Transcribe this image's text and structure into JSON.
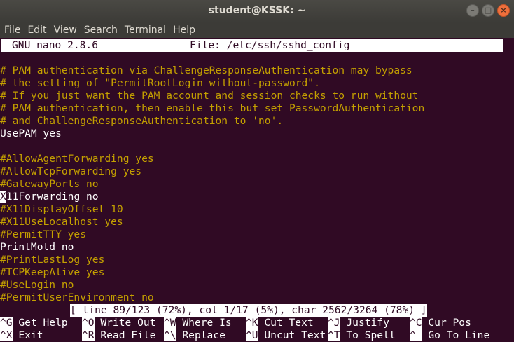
{
  "window": {
    "title": "student@KSSK: ~"
  },
  "menu": [
    "File",
    "Edit",
    "View",
    "Search",
    "Terminal",
    "Help"
  ],
  "editor": {
    "program": "GNU nano 2.8.6",
    "file": "File: /etc/ssh/sshd_config"
  },
  "lines": [
    {
      "text": "",
      "type": "plain"
    },
    {
      "text": "# PAM authentication via ChallengeResponseAuthentication may bypass",
      "type": "comment"
    },
    {
      "text": "# the setting of \"PermitRootLogin without-password\".",
      "type": "comment"
    },
    {
      "text": "# If you just want the PAM account and session checks to run without",
      "type": "comment"
    },
    {
      "text": "# PAM authentication, then enable this but set PasswordAuthentication",
      "type": "comment"
    },
    {
      "text": "# and ChallengeResponseAuthentication to 'no'.",
      "type": "comment"
    },
    {
      "text": "UsePAM yes",
      "type": "plain"
    },
    {
      "text": "",
      "type": "plain"
    },
    {
      "text": "#AllowAgentForwarding yes",
      "type": "comment"
    },
    {
      "text": "#AllowTcpForwarding yes",
      "type": "comment"
    },
    {
      "text": "#GatewayPorts no",
      "type": "comment"
    },
    {
      "text": "X11Forwarding no",
      "type": "cursor"
    },
    {
      "text": "#X11DisplayOffset 10",
      "type": "comment"
    },
    {
      "text": "#X11UseLocalhost yes",
      "type": "comment"
    },
    {
      "text": "#PermitTTY yes",
      "type": "comment"
    },
    {
      "text": "PrintMotd no",
      "type": "plain"
    },
    {
      "text": "#PrintLastLog yes",
      "type": "comment"
    },
    {
      "text": "#TCPKeepAlive yes",
      "type": "comment"
    },
    {
      "text": "#UseLogin no",
      "type": "comment"
    },
    {
      "text": "#PermitUserEnvironment no",
      "type": "comment"
    }
  ],
  "status": "[ line 89/123 (72%), col 1/17 (5%), char 2562/3264 (78%) ]",
  "shortcuts": [
    {
      "key": "^G",
      "label": "Get Help"
    },
    {
      "key": "^O",
      "label": "Write Out"
    },
    {
      "key": "^W",
      "label": "Where Is"
    },
    {
      "key": "^K",
      "label": "Cut Text"
    },
    {
      "key": "^J",
      "label": "Justify"
    },
    {
      "key": "^C",
      "label": "Cur Pos"
    },
    {
      "key": "^X",
      "label": "Exit"
    },
    {
      "key": "^R",
      "label": "Read File"
    },
    {
      "key": "^\\",
      "label": "Replace"
    },
    {
      "key": "^U",
      "label": "Uncut Text"
    },
    {
      "key": "^T",
      "label": "To Spell"
    },
    {
      "key": "^_",
      "label": "Go To Line"
    }
  ],
  "colors": {
    "background": "#300a24",
    "comment": "#c4a000",
    "text": "#ffffff"
  }
}
